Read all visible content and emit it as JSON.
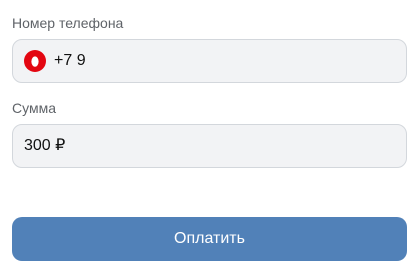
{
  "phone": {
    "label": "Номер телефона",
    "value": "+7 9",
    "operator_icon": "mts-egg-icon",
    "operator_color": "#e30611"
  },
  "amount": {
    "label": "Сумма",
    "value": "300 ₽"
  },
  "pay_button": {
    "label": "Оплатить",
    "color": "#5181b8"
  }
}
